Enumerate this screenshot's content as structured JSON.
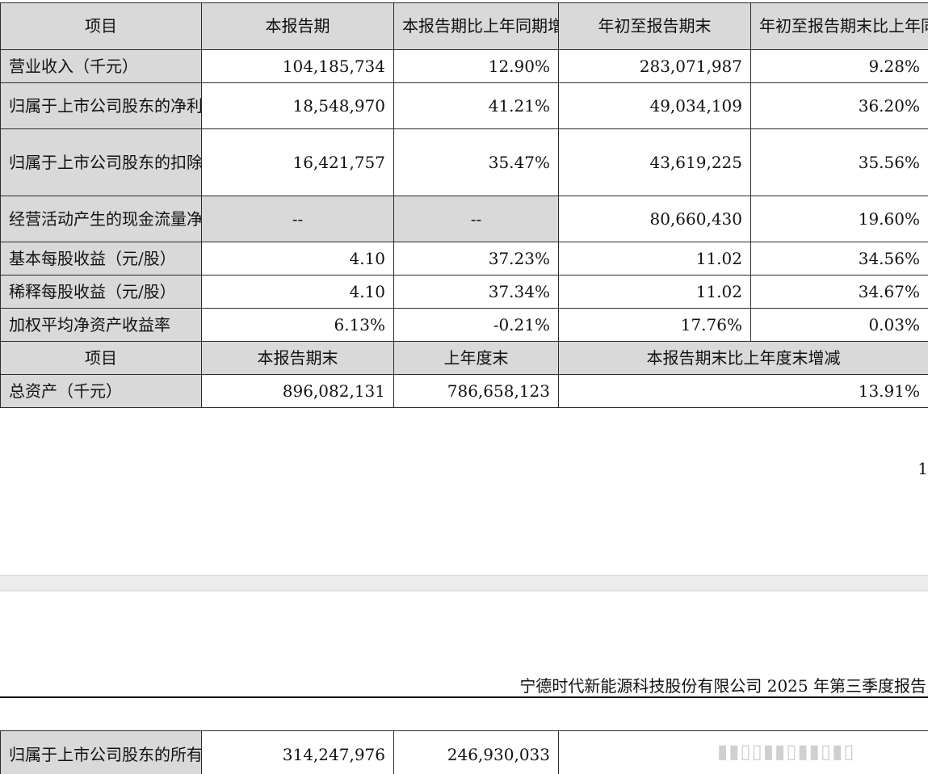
{
  "main_table": {
    "header": {
      "item": "项目",
      "current_period": "本报告期",
      "current_period_yoy": "本报告期比上年同期增减",
      "ytd": "年初至报告期末",
      "ytd_yoy": "年初至报告期末比上年同期增减"
    },
    "rows": [
      {
        "label": "营业收入（千元）",
        "current": "104,185,734",
        "current_yoy": "12.90%",
        "ytd": "283,071,987",
        "ytd_yoy": "9.28%"
      },
      {
        "label": "归属于上市公司股东的净利润（千元）",
        "current": "18,548,970",
        "current_yoy": "41.21%",
        "ytd": "49,034,109",
        "ytd_yoy": "36.20%"
      },
      {
        "label": "归属于上市公司股东的扣除非经常性损益的净利润（千元）",
        "current": "16,421,757",
        "current_yoy": "35.47%",
        "ytd": "43,619,225",
        "ytd_yoy": "35.56%"
      },
      {
        "label": "经营活动产生的现金流量净额（千元）",
        "current": "--",
        "current_yoy": "--",
        "ytd": "80,660,430",
        "ytd_yoy": "19.60%"
      },
      {
        "label": "基本每股收益（元/股）",
        "current": "4.10",
        "current_yoy": "37.23%",
        "ytd": "11.02",
        "ytd_yoy": "34.56%"
      },
      {
        "label": "稀释每股收益（元/股）",
        "current": "4.10",
        "current_yoy": "37.34%",
        "ytd": "11.02",
        "ytd_yoy": "34.67%"
      },
      {
        "label": "加权平均净资产收益率",
        "current": "6.13%",
        "current_yoy": "-0.21%",
        "ytd": "17.76%",
        "ytd_yoy": "0.03%"
      }
    ],
    "header2": {
      "item": "项目",
      "period_end": "本报告期末",
      "prior_year_end": "上年度末",
      "change": "本报告期末比上年度末增减"
    },
    "total_assets": {
      "label": "总资产（千元）",
      "period_end": "896,082,131",
      "prior_year_end": "786,658,123",
      "change": "13.91%"
    }
  },
  "page_number": "1",
  "report_header": "宁德时代新能源科技股份有限公司 2025 年第三季度报告",
  "equity_row": {
    "label": "归属于上市公司股东的所有者权益（千元）",
    "period_end": "314,247,976",
    "prior_year_end": "246,930,033"
  },
  "colors": {
    "header_gray": "#d9d9d9",
    "border": "#2b2b2b",
    "page_break": "#ececec"
  }
}
